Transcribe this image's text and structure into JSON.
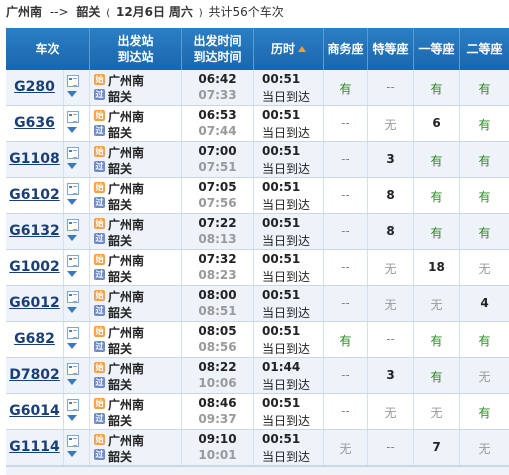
{
  "header": {
    "from": "广州南",
    "arrow": "-->",
    "to": "韶关",
    "open_paren": "(",
    "date": "12月6日",
    "weekday": "周六",
    "close": ")",
    "summary": "共计56个车次"
  },
  "columns": {
    "train": "车次",
    "depart_station": "出发站",
    "arrive_station": "到达站",
    "depart_time": "出发时间",
    "arrive_time": "到达时间",
    "duration": "历时",
    "seat_business": "商务座",
    "seat_special": "特等座",
    "seat_first": "一等座",
    "seat_second": "二等座"
  },
  "badges": {
    "start": "始",
    "pass": "过"
  },
  "rows": [
    {
      "train": "G280",
      "from": "广州南",
      "to": "韶关",
      "dep": "06:42",
      "arr": "07:33",
      "dur": "00:51",
      "note": "当日到达",
      "s1": "有",
      "s2": "--",
      "s3": "有",
      "s4": "有"
    },
    {
      "train": "G636",
      "from": "广州南",
      "to": "韶关",
      "dep": "06:53",
      "arr": "07:44",
      "dur": "00:51",
      "note": "当日到达",
      "s1": "--",
      "s2": "无",
      "s3": "6",
      "s4": "有"
    },
    {
      "train": "G1108",
      "from": "广州南",
      "to": "韶关",
      "dep": "07:00",
      "arr": "07:51",
      "dur": "00:51",
      "note": "当日到达",
      "s1": "--",
      "s2": "3",
      "s3": "有",
      "s4": "有"
    },
    {
      "train": "G6102",
      "from": "广州南",
      "to": "韶关",
      "dep": "07:05",
      "arr": "07:56",
      "dur": "00:51",
      "note": "当日到达",
      "s1": "--",
      "s2": "8",
      "s3": "有",
      "s4": "有"
    },
    {
      "train": "G6132",
      "from": "广州南",
      "to": "韶关",
      "dep": "07:22",
      "arr": "08:13",
      "dur": "00:51",
      "note": "当日到达",
      "s1": "--",
      "s2": "8",
      "s3": "有",
      "s4": "有"
    },
    {
      "train": "G1002",
      "from": "广州南",
      "to": "韶关",
      "dep": "07:32",
      "arr": "08:23",
      "dur": "00:51",
      "note": "当日到达",
      "s1": "--",
      "s2": "无",
      "s3": "18",
      "s4": "无"
    },
    {
      "train": "G6012",
      "from": "广州南",
      "to": "韶关",
      "dep": "08:00",
      "arr": "08:51",
      "dur": "00:51",
      "note": "当日到达",
      "s1": "--",
      "s2": "无",
      "s3": "无",
      "s4": "4"
    },
    {
      "train": "G682",
      "from": "广州南",
      "to": "韶关",
      "dep": "08:05",
      "arr": "08:56",
      "dur": "00:51",
      "note": "当日到达",
      "s1": "有",
      "s2": "--",
      "s3": "有",
      "s4": "有"
    },
    {
      "train": "D7802",
      "from": "广州南",
      "to": "韶关",
      "dep": "08:22",
      "arr": "10:06",
      "dur": "01:44",
      "note": "当日到达",
      "s1": "--",
      "s2": "3",
      "s3": "有",
      "s4": "无"
    },
    {
      "train": "G6014",
      "from": "广州南",
      "to": "韶关",
      "dep": "08:46",
      "arr": "09:37",
      "dur": "00:51",
      "note": "当日到达",
      "s1": "--",
      "s2": "无",
      "s3": "无",
      "s4": "有"
    },
    {
      "train": "G1114",
      "from": "广州南",
      "to": "韶关",
      "dep": "09:10",
      "arr": "10:01",
      "dur": "00:51",
      "note": "当日到达",
      "s1": "无",
      "s2": "--",
      "s3": "7",
      "s4": "无"
    }
  ]
}
